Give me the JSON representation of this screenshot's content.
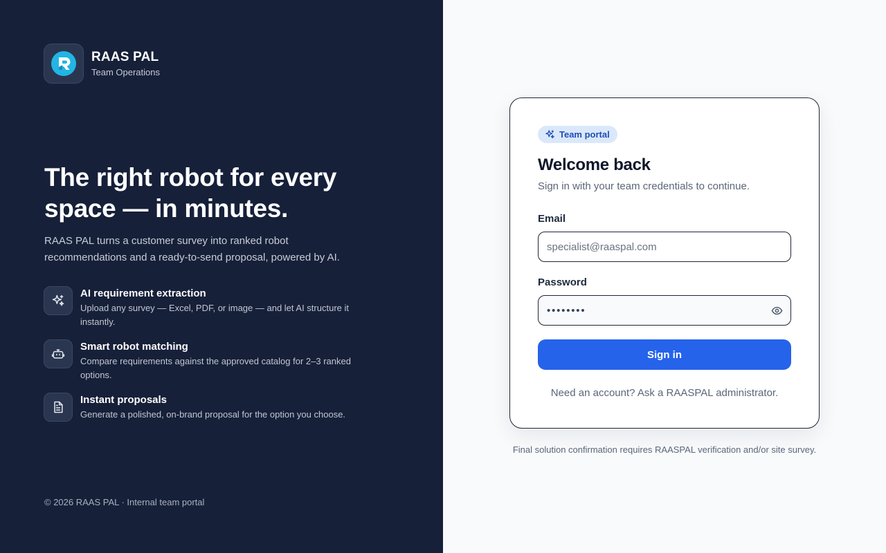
{
  "brand": {
    "name": "RAAS PAL",
    "subtitle": "Team Operations",
    "accent": "#22b5e5"
  },
  "hero": {
    "title": "The right robot for every space — in minutes.",
    "description": "RAAS PAL turns a customer survey into ranked robot recommendations and a ready-to-send proposal, powered by AI."
  },
  "features": [
    {
      "icon": "sparkles-icon",
      "title": "AI requirement extraction",
      "description": "Upload any survey — Excel, PDF, or image — and let AI structure it instantly."
    },
    {
      "icon": "robot-icon",
      "title": "Smart robot matching",
      "description": "Compare requirements against the approved catalog for 2–3 ranked options."
    },
    {
      "icon": "document-icon",
      "title": "Instant proposals",
      "description": "Generate a polished, on-brand proposal for the option you choose."
    }
  ],
  "copyright": "© 2026 RAAS PAL · Internal team portal",
  "login": {
    "badge": "Team portal",
    "title": "Welcome back",
    "subtitle": "Sign in with your team credentials to continue.",
    "email_label": "Email",
    "email_placeholder": "specialist@raaspal.com",
    "email_value": "",
    "password_label": "Password",
    "password_value": "••••••••",
    "submit_label": "Sign in",
    "help_text": "Need an account? Ask a RAASPAL administrator."
  },
  "footnote": "Final solution confirmation requires RAASPAL verification and/or site survey.",
  "colors": {
    "left_panel_bg": "#172039",
    "primary_button": "#2563eb",
    "badge_bg": "#dbe8fb",
    "badge_text": "#1e4fb5"
  }
}
